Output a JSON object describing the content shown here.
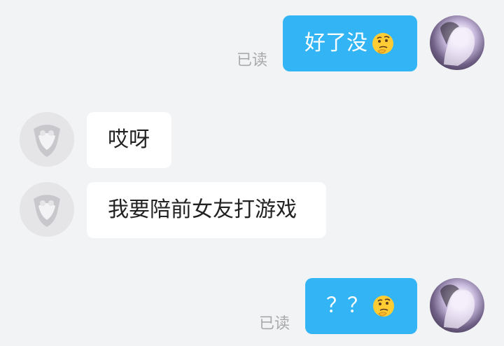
{
  "messages": [
    {
      "id": "m1",
      "sender": "me",
      "text": "好了没",
      "emoji": "thinking-face",
      "read_label": "已读"
    },
    {
      "id": "m2",
      "sender": "other",
      "text": "哎呀"
    },
    {
      "id": "m3",
      "sender": "other",
      "text": "我要陪前女友打游戏"
    },
    {
      "id": "m4",
      "sender": "me",
      "text": "？？",
      "emoji": "thinking-face",
      "read_label": "已读"
    }
  ],
  "colors": {
    "background": "#f2f3f5",
    "outgoing_bubble": "#33b5f5",
    "incoming_bubble": "#ffffff",
    "read_label": "#a9a9ad"
  }
}
